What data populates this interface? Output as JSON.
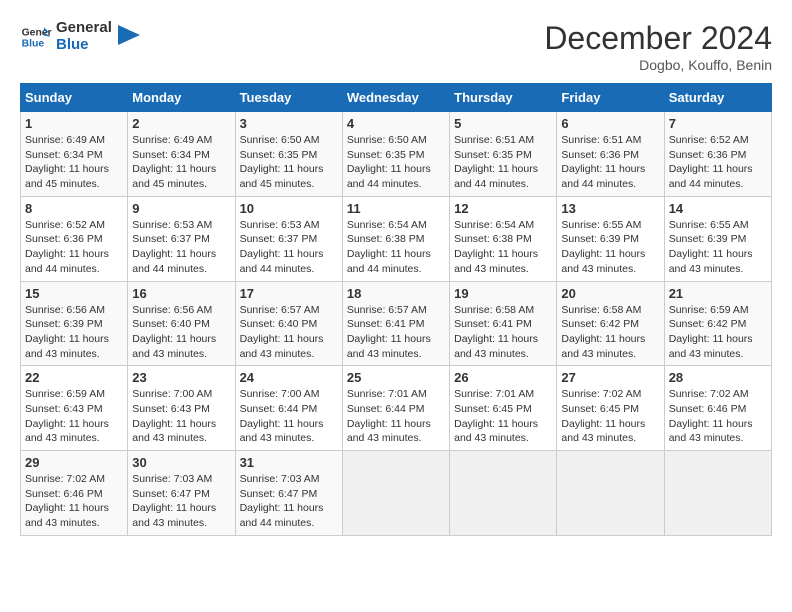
{
  "logo": {
    "line1": "General",
    "line2": "Blue"
  },
  "title": "December 2024",
  "location": "Dogbo, Kouffo, Benin",
  "weekdays": [
    "Sunday",
    "Monday",
    "Tuesday",
    "Wednesday",
    "Thursday",
    "Friday",
    "Saturday"
  ],
  "weeks": [
    [
      {
        "day": "1",
        "sunrise": "6:49 AM",
        "sunset": "6:34 PM",
        "daylight": "11 hours and 45 minutes."
      },
      {
        "day": "2",
        "sunrise": "6:49 AM",
        "sunset": "6:34 PM",
        "daylight": "11 hours and 45 minutes."
      },
      {
        "day": "3",
        "sunrise": "6:50 AM",
        "sunset": "6:35 PM",
        "daylight": "11 hours and 45 minutes."
      },
      {
        "day": "4",
        "sunrise": "6:50 AM",
        "sunset": "6:35 PM",
        "daylight": "11 hours and 44 minutes."
      },
      {
        "day": "5",
        "sunrise": "6:51 AM",
        "sunset": "6:35 PM",
        "daylight": "11 hours and 44 minutes."
      },
      {
        "day": "6",
        "sunrise": "6:51 AM",
        "sunset": "6:36 PM",
        "daylight": "11 hours and 44 minutes."
      },
      {
        "day": "7",
        "sunrise": "6:52 AM",
        "sunset": "6:36 PM",
        "daylight": "11 hours and 44 minutes."
      }
    ],
    [
      {
        "day": "8",
        "sunrise": "6:52 AM",
        "sunset": "6:36 PM",
        "daylight": "11 hours and 44 minutes."
      },
      {
        "day": "9",
        "sunrise": "6:53 AM",
        "sunset": "6:37 PM",
        "daylight": "11 hours and 44 minutes."
      },
      {
        "day": "10",
        "sunrise": "6:53 AM",
        "sunset": "6:37 PM",
        "daylight": "11 hours and 44 minutes."
      },
      {
        "day": "11",
        "sunrise": "6:54 AM",
        "sunset": "6:38 PM",
        "daylight": "11 hours and 44 minutes."
      },
      {
        "day": "12",
        "sunrise": "6:54 AM",
        "sunset": "6:38 PM",
        "daylight": "11 hours and 43 minutes."
      },
      {
        "day": "13",
        "sunrise": "6:55 AM",
        "sunset": "6:39 PM",
        "daylight": "11 hours and 43 minutes."
      },
      {
        "day": "14",
        "sunrise": "6:55 AM",
        "sunset": "6:39 PM",
        "daylight": "11 hours and 43 minutes."
      }
    ],
    [
      {
        "day": "15",
        "sunrise": "6:56 AM",
        "sunset": "6:39 PM",
        "daylight": "11 hours and 43 minutes."
      },
      {
        "day": "16",
        "sunrise": "6:56 AM",
        "sunset": "6:40 PM",
        "daylight": "11 hours and 43 minutes."
      },
      {
        "day": "17",
        "sunrise": "6:57 AM",
        "sunset": "6:40 PM",
        "daylight": "11 hours and 43 minutes."
      },
      {
        "day": "18",
        "sunrise": "6:57 AM",
        "sunset": "6:41 PM",
        "daylight": "11 hours and 43 minutes."
      },
      {
        "day": "19",
        "sunrise": "6:58 AM",
        "sunset": "6:41 PM",
        "daylight": "11 hours and 43 minutes."
      },
      {
        "day": "20",
        "sunrise": "6:58 AM",
        "sunset": "6:42 PM",
        "daylight": "11 hours and 43 minutes."
      },
      {
        "day": "21",
        "sunrise": "6:59 AM",
        "sunset": "6:42 PM",
        "daylight": "11 hours and 43 minutes."
      }
    ],
    [
      {
        "day": "22",
        "sunrise": "6:59 AM",
        "sunset": "6:43 PM",
        "daylight": "11 hours and 43 minutes."
      },
      {
        "day": "23",
        "sunrise": "7:00 AM",
        "sunset": "6:43 PM",
        "daylight": "11 hours and 43 minutes."
      },
      {
        "day": "24",
        "sunrise": "7:00 AM",
        "sunset": "6:44 PM",
        "daylight": "11 hours and 43 minutes."
      },
      {
        "day": "25",
        "sunrise": "7:01 AM",
        "sunset": "6:44 PM",
        "daylight": "11 hours and 43 minutes."
      },
      {
        "day": "26",
        "sunrise": "7:01 AM",
        "sunset": "6:45 PM",
        "daylight": "11 hours and 43 minutes."
      },
      {
        "day": "27",
        "sunrise": "7:02 AM",
        "sunset": "6:45 PM",
        "daylight": "11 hours and 43 minutes."
      },
      {
        "day": "28",
        "sunrise": "7:02 AM",
        "sunset": "6:46 PM",
        "daylight": "11 hours and 43 minutes."
      }
    ],
    [
      {
        "day": "29",
        "sunrise": "7:02 AM",
        "sunset": "6:46 PM",
        "daylight": "11 hours and 43 minutes."
      },
      {
        "day": "30",
        "sunrise": "7:03 AM",
        "sunset": "6:47 PM",
        "daylight": "11 hours and 43 minutes."
      },
      {
        "day": "31",
        "sunrise": "7:03 AM",
        "sunset": "6:47 PM",
        "daylight": "11 hours and 44 minutes."
      },
      null,
      null,
      null,
      null
    ]
  ],
  "colors": {
    "header_bg": "#1a6bb5",
    "header_text": "#ffffff",
    "accent_blue": "#1a6bb5"
  }
}
